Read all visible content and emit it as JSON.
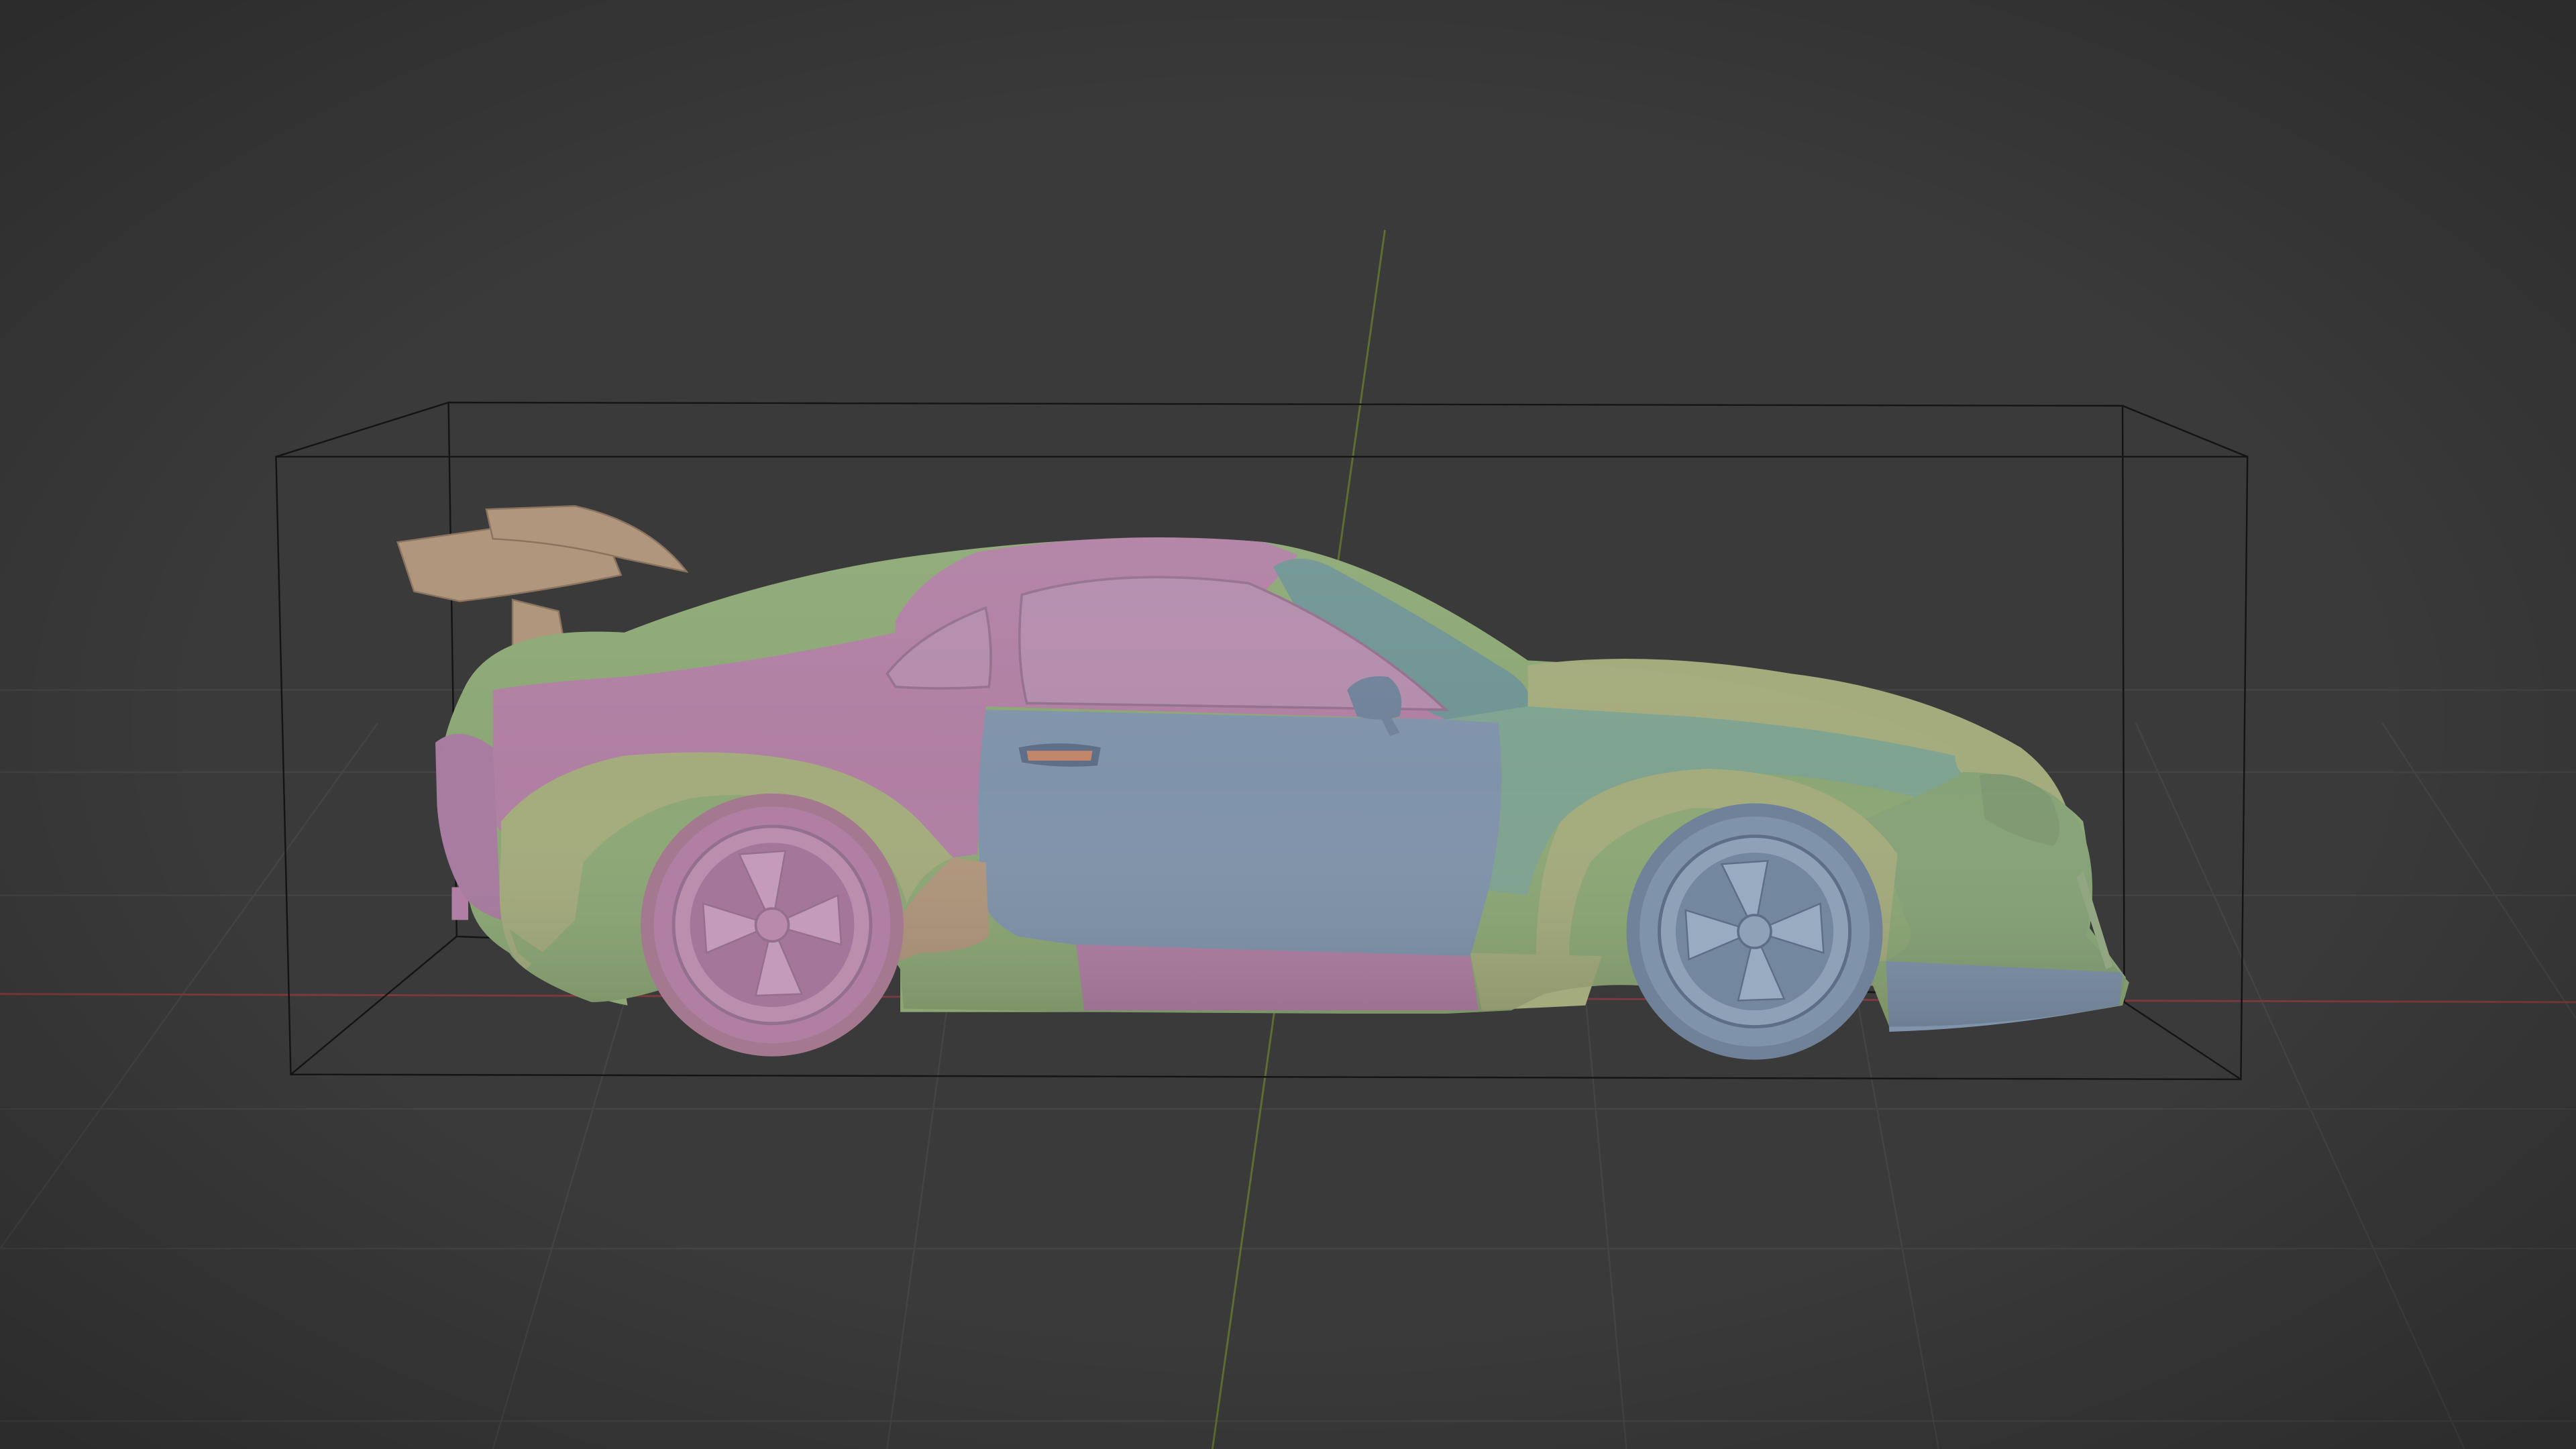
{
  "viewport": {
    "background": "#3a3a3a",
    "grid_color": "#444444",
    "axis_x_color": "#7d3a3e",
    "axis_y_color": "#5e6e33",
    "bounding_box_color": "#141414",
    "shading": "solid",
    "color_mode": "random"
  },
  "object": {
    "kind": "sports-car",
    "body_colors": {
      "pink": "#b07fa3",
      "blue": "#7f93aa",
      "green": "#8ca775",
      "teal": "#7fa391",
      "sage": "#a4ab7c",
      "tan": "#b0967c"
    }
  }
}
